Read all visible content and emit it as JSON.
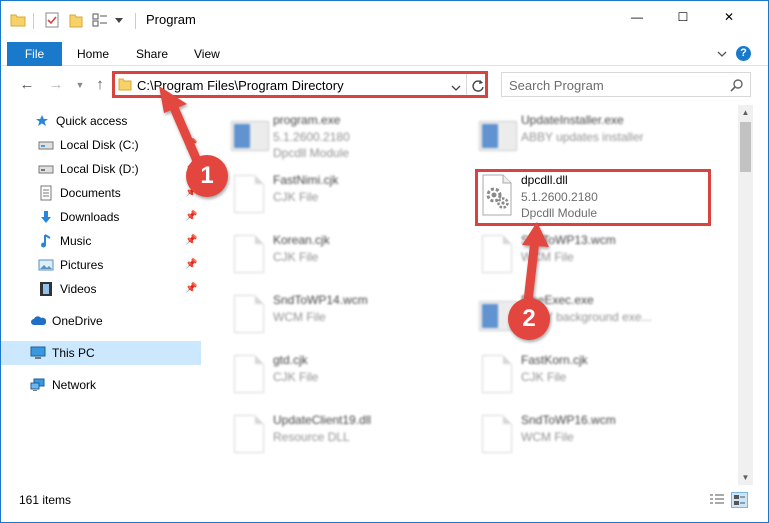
{
  "window": {
    "title": "Program",
    "controls": {
      "minimize": "—",
      "maximize": "☐",
      "close": "✕"
    }
  },
  "ribbon": {
    "tabs": [
      "File",
      "Home",
      "Share",
      "View"
    ],
    "help": "?"
  },
  "address": {
    "path": "C:\\Program Files\\Program Directory",
    "search_placeholder": "Search Program"
  },
  "sidebar": {
    "items": [
      {
        "label": "Quick access",
        "icon": "star-icon",
        "pinned": false
      },
      {
        "label": "Local Disk (C:)",
        "icon": "drive-icon",
        "pinned": true
      },
      {
        "label": "Local Disk (D:)",
        "icon": "drive-icon",
        "pinned": true
      },
      {
        "label": "Documents",
        "icon": "documents-icon",
        "pinned": true
      },
      {
        "label": "Downloads",
        "icon": "downloads-icon",
        "pinned": true
      },
      {
        "label": "Music",
        "icon": "music-icon",
        "pinned": true
      },
      {
        "label": "Pictures",
        "icon": "pictures-icon",
        "pinned": true
      },
      {
        "label": "Videos",
        "icon": "videos-icon",
        "pinned": true
      },
      {
        "label": "OneDrive",
        "icon": "onedrive-icon",
        "pinned": false
      },
      {
        "label": "This PC",
        "icon": "this-pc-icon",
        "pinned": false,
        "selected": true
      },
      {
        "label": "Network",
        "icon": "network-icon",
        "pinned": false
      }
    ]
  },
  "files": [
    {
      "name": "program.exe",
      "line2": "5.1.2600.2180",
      "line3": "Dpcdll Module",
      "icon": "app-icon",
      "blurred": true
    },
    {
      "name": "UpdateInstaller.exe",
      "line2": "ABBY updates installer",
      "line3": "",
      "icon": "app-icon",
      "blurred": true
    },
    {
      "name": "FastNimi.cjk",
      "line2": "CJK File",
      "line3": "",
      "icon": "document-icon",
      "blurred": true
    },
    {
      "name": "dpcdll.dll",
      "line2": "5.1.2600.2180",
      "line3": "Dpcdll Module",
      "icon": "dll-gear-icon",
      "blurred": false
    },
    {
      "name": "Korean.cjk",
      "line2": "CJK File",
      "line3": "",
      "icon": "document-icon",
      "blurred": true
    },
    {
      "name": "SndToWP13.wcm",
      "line2": "WCM File",
      "line3": "",
      "icon": "document-icon",
      "blurred": true
    },
    {
      "name": "SndToWP14.wcm",
      "line2": "WCM File",
      "line3": "",
      "icon": "document-icon",
      "blurred": true
    },
    {
      "name": "FineExec.exe",
      "line2": "ABBY background exe...",
      "line3": "",
      "icon": "app-icon",
      "blurred": true
    },
    {
      "name": "gtd.cjk",
      "line2": "CJK File",
      "line3": "",
      "icon": "document-icon",
      "blurred": true
    },
    {
      "name": "FastKorn.cjk",
      "line2": "CJK File",
      "line3": "",
      "icon": "document-icon",
      "blurred": true
    },
    {
      "name": "UpdateClient19.dll",
      "line2": "Resource DLL",
      "line3": "",
      "icon": "document-icon",
      "blurred": true
    },
    {
      "name": "SndToWP16.wcm",
      "line2": "WCM File",
      "line3": "",
      "icon": "document-icon",
      "blurred": true
    }
  ],
  "status": {
    "item_count": "161 items"
  },
  "annotations": {
    "callout1": "1",
    "callout2": "2",
    "color": "#e2463f"
  }
}
